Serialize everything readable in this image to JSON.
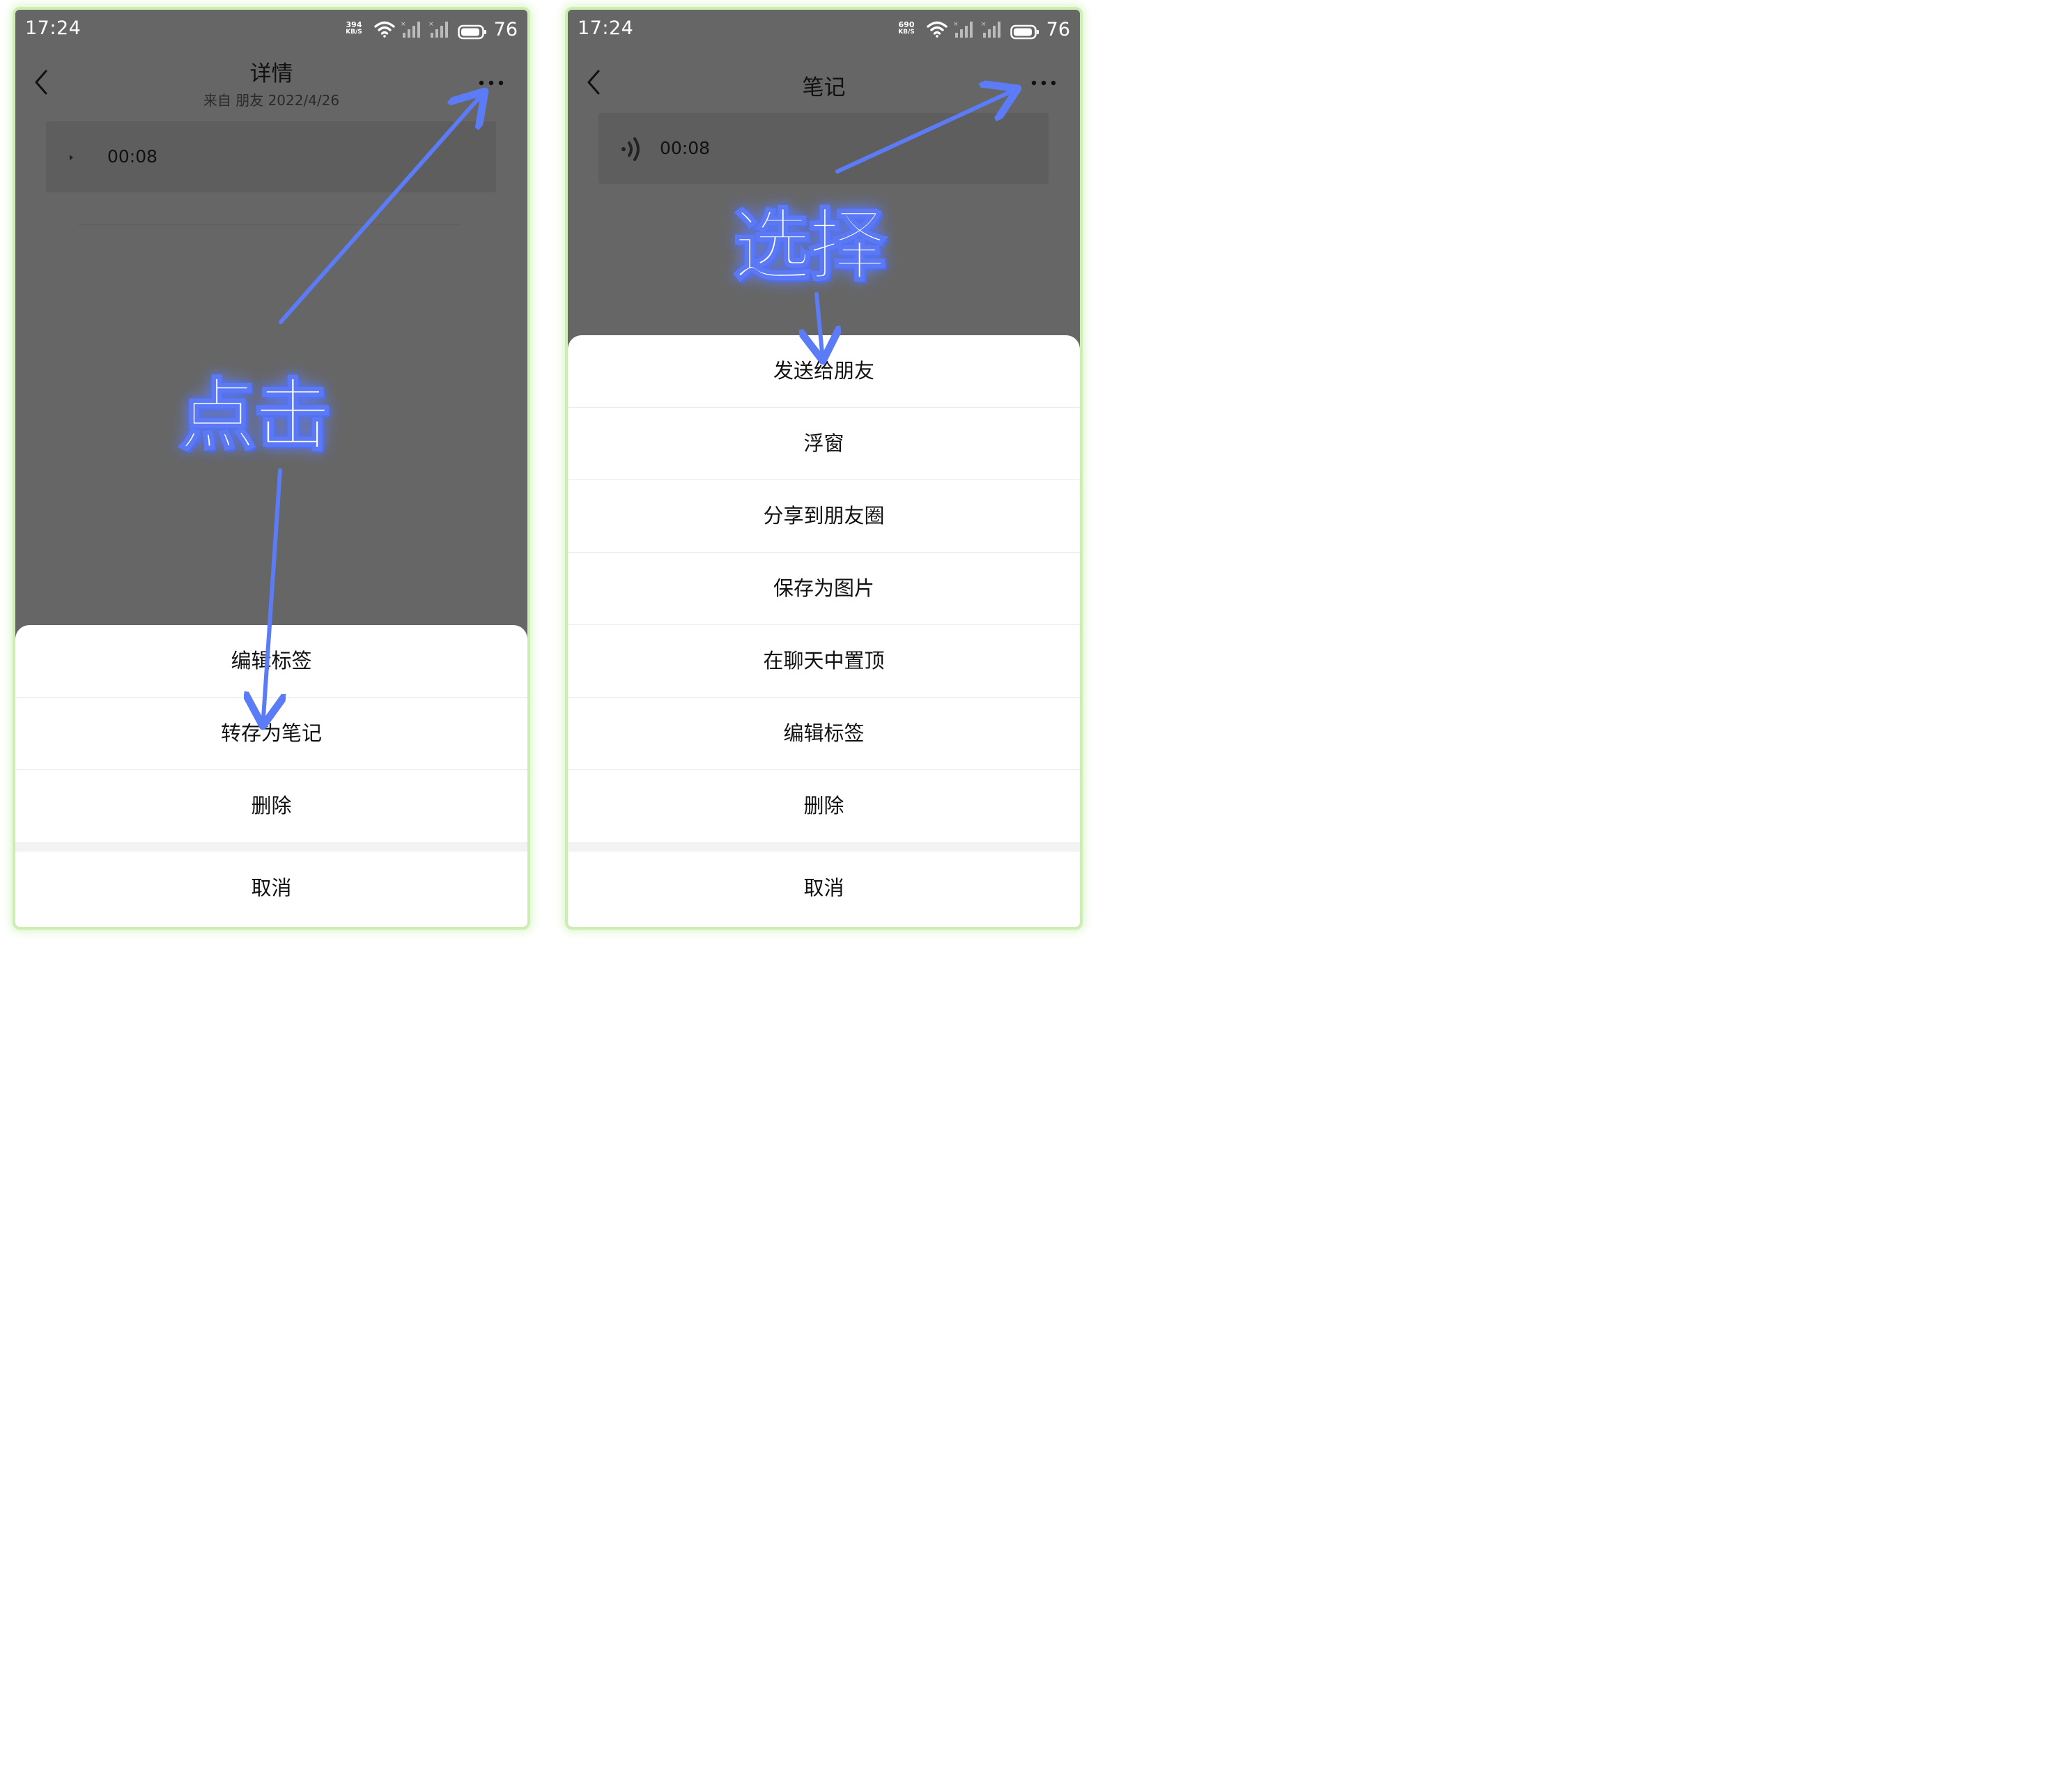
{
  "left_screen": {
    "status": {
      "time": "17:24",
      "net_speed_value": "394",
      "net_speed_unit": "KB/S",
      "battery": "76"
    },
    "nav": {
      "title": "详情",
      "subtitle": "来自 朋友 2022/4/26",
      "back_icon": "chevron-left-icon",
      "more_icon": "more-dots-icon"
    },
    "voice": {
      "duration": "00:08",
      "icon": "voice-play-icon"
    },
    "sheet": {
      "items": [
        "编辑标签",
        "转存为笔记",
        "删除"
      ],
      "cancel": "取消"
    }
  },
  "right_screen": {
    "status": {
      "time": "17:24",
      "net_speed_value": "690",
      "net_speed_unit": "KB/S",
      "battery": "76"
    },
    "nav": {
      "title": "笔记",
      "back_icon": "chevron-left-icon",
      "more_icon": "more-dots-icon"
    },
    "voice": {
      "duration": "00:08",
      "icon": "voice-wave-icon"
    },
    "sheet": {
      "items": [
        "发送给朋友",
        "浮窗",
        "分享到朋友圈",
        "保存为图片",
        "在聊天中置顶",
        "编辑标签",
        "删除"
      ],
      "cancel": "取消"
    }
  },
  "annotations": {
    "left_label": "点击",
    "right_label": "选择",
    "arrow_color": "#5b7cf6"
  },
  "colors": {
    "dim_overlay": "#666666",
    "sheet_bg": "#ffffff",
    "frame_glow": "#cdeeb3"
  }
}
